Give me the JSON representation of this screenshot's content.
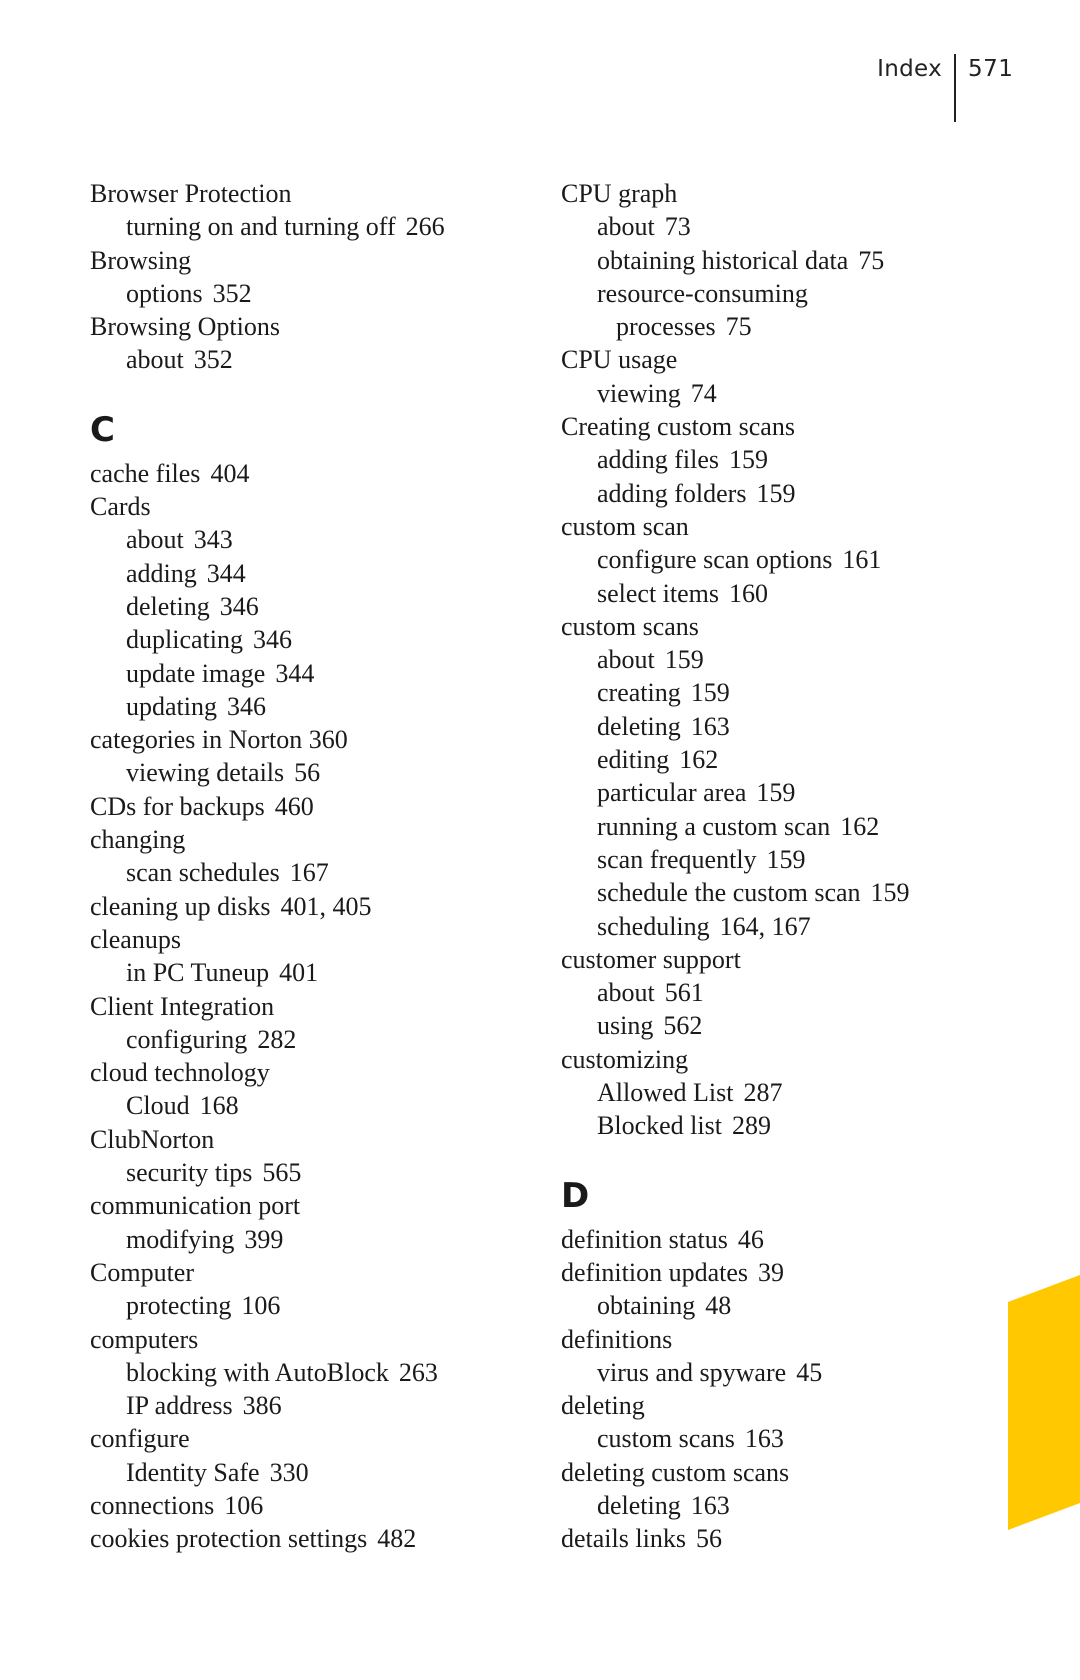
{
  "header": {
    "section": "Index",
    "page_number": "571"
  },
  "tab_color": "#FFC800",
  "columns": [
    {
      "blocks": [
        {
          "type": "entries",
          "lines": [
            {
              "level": 0,
              "term": "Browser Protection",
              "pages": ""
            },
            {
              "level": 1,
              "term": "turning on and turning off",
              "pages": "266"
            },
            {
              "level": 0,
              "term": "Browsing",
              "pages": ""
            },
            {
              "level": 1,
              "term": "options",
              "pages": "352"
            },
            {
              "level": 0,
              "term": "Browsing Options",
              "pages": ""
            },
            {
              "level": 1,
              "term": "about",
              "pages": "352"
            }
          ]
        },
        {
          "type": "letter",
          "letter": "C"
        },
        {
          "type": "entries",
          "lines": [
            {
              "level": 0,
              "term": "cache files",
              "pages": "404"
            },
            {
              "level": 0,
              "term": "Cards",
              "pages": ""
            },
            {
              "level": 1,
              "term": "about",
              "pages": "343"
            },
            {
              "level": 1,
              "term": "adding",
              "pages": "344"
            },
            {
              "level": 1,
              "term": "deleting",
              "pages": "346"
            },
            {
              "level": 1,
              "term": "duplicating",
              "pages": "346"
            },
            {
              "level": 1,
              "term": "update image",
              "pages": "344"
            },
            {
              "level": 1,
              "term": "updating",
              "pages": "346"
            },
            {
              "level": 0,
              "term": "categories in Norton 360",
              "pages": ""
            },
            {
              "level": 1,
              "term": "viewing details",
              "pages": "56"
            },
            {
              "level": 0,
              "term": "CDs for backups",
              "pages": "460"
            },
            {
              "level": 0,
              "term": "changing",
              "pages": ""
            },
            {
              "level": 1,
              "term": "scan schedules",
              "pages": "167"
            },
            {
              "level": 0,
              "term": "cleaning up disks",
              "pages": "401, 405"
            },
            {
              "level": 0,
              "term": "cleanups",
              "pages": ""
            },
            {
              "level": 1,
              "term": "in PC Tuneup",
              "pages": "401"
            },
            {
              "level": 0,
              "term": "Client Integration",
              "pages": ""
            },
            {
              "level": 1,
              "term": "configuring",
              "pages": "282"
            },
            {
              "level": 0,
              "term": "cloud technology",
              "pages": ""
            },
            {
              "level": 1,
              "term": "Cloud",
              "pages": "168"
            },
            {
              "level": 0,
              "term": "ClubNorton",
              "pages": ""
            },
            {
              "level": 1,
              "term": "security tips",
              "pages": "565"
            },
            {
              "level": 0,
              "term": "communication port",
              "pages": ""
            },
            {
              "level": 1,
              "term": "modifying",
              "pages": "399"
            },
            {
              "level": 0,
              "term": "Computer",
              "pages": ""
            },
            {
              "level": 1,
              "term": "protecting",
              "pages": "106"
            },
            {
              "level": 0,
              "term": "computers",
              "pages": ""
            },
            {
              "level": 1,
              "term": "blocking with AutoBlock",
              "pages": "263"
            },
            {
              "level": 1,
              "term": "IP address",
              "pages": "386"
            },
            {
              "level": 0,
              "term": "configure",
              "pages": ""
            },
            {
              "level": 1,
              "term": "Identity Safe",
              "pages": "330"
            },
            {
              "level": 0,
              "term": "connections",
              "pages": "106"
            },
            {
              "level": 0,
              "term": "cookies protection settings",
              "pages": "482"
            }
          ]
        }
      ]
    },
    {
      "blocks": [
        {
          "type": "entries",
          "lines": [
            {
              "level": 0,
              "term": "CPU graph",
              "pages": ""
            },
            {
              "level": 1,
              "term": "about",
              "pages": "73"
            },
            {
              "level": 1,
              "term": "obtaining historical data",
              "pages": "75"
            },
            {
              "level": 1,
              "term": "resource-consuming",
              "pages": ""
            },
            {
              "level": 2,
              "term": "processes",
              "pages": "75"
            },
            {
              "level": 0,
              "term": "CPU usage",
              "pages": ""
            },
            {
              "level": 1,
              "term": "viewing",
              "pages": "74"
            },
            {
              "level": 0,
              "term": "Creating custom scans",
              "pages": ""
            },
            {
              "level": 1,
              "term": "adding files",
              "pages": "159"
            },
            {
              "level": 1,
              "term": "adding folders",
              "pages": "159"
            },
            {
              "level": 0,
              "term": "custom scan",
              "pages": ""
            },
            {
              "level": 1,
              "term": "configure scan options",
              "pages": "161"
            },
            {
              "level": 1,
              "term": "select items",
              "pages": "160"
            },
            {
              "level": 0,
              "term": "custom scans",
              "pages": ""
            },
            {
              "level": 1,
              "term": "about",
              "pages": "159"
            },
            {
              "level": 1,
              "term": "creating",
              "pages": "159"
            },
            {
              "level": 1,
              "term": "deleting",
              "pages": "163"
            },
            {
              "level": 1,
              "term": "editing",
              "pages": "162"
            },
            {
              "level": 1,
              "term": "particular area",
              "pages": "159"
            },
            {
              "level": 1,
              "term": "running a custom scan",
              "pages": "162"
            },
            {
              "level": 1,
              "term": "scan frequently",
              "pages": "159"
            },
            {
              "level": 1,
              "term": "schedule the custom scan",
              "pages": "159"
            },
            {
              "level": 1,
              "term": "scheduling",
              "pages": "164, 167"
            },
            {
              "level": 0,
              "term": "customer support",
              "pages": ""
            },
            {
              "level": 1,
              "term": "about",
              "pages": "561"
            },
            {
              "level": 1,
              "term": "using",
              "pages": "562"
            },
            {
              "level": 0,
              "term": "customizing",
              "pages": ""
            },
            {
              "level": 1,
              "term": "Allowed List",
              "pages": "287"
            },
            {
              "level": 1,
              "term": "Blocked list",
              "pages": "289"
            }
          ]
        },
        {
          "type": "letter",
          "letter": "D"
        },
        {
          "type": "entries",
          "lines": [
            {
              "level": 0,
              "term": "definition status",
              "pages": "46"
            },
            {
              "level": 0,
              "term": "definition updates",
              "pages": "39"
            },
            {
              "level": 1,
              "term": "obtaining",
              "pages": "48"
            },
            {
              "level": 0,
              "term": "definitions",
              "pages": ""
            },
            {
              "level": 1,
              "term": "virus and spyware",
              "pages": "45"
            },
            {
              "level": 0,
              "term": "deleting",
              "pages": ""
            },
            {
              "level": 1,
              "term": "custom scans",
              "pages": "163"
            },
            {
              "level": 0,
              "term": "deleting custom scans",
              "pages": ""
            },
            {
              "level": 1,
              "term": "deleting",
              "pages": "163"
            },
            {
              "level": 0,
              "term": "details links",
              "pages": "56"
            }
          ]
        }
      ]
    }
  ]
}
